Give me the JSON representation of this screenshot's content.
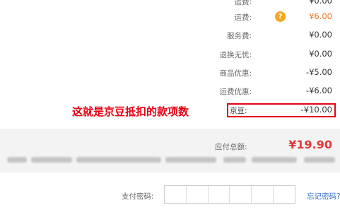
{
  "fees": [
    {
      "label": "运费:",
      "value": "¥0.00"
    },
    {
      "label": "运费:",
      "value": "¥6.00",
      "info_icon": "?"
    },
    {
      "label": "服务费:",
      "value": "¥0.00"
    },
    {
      "label": "退换无忧:",
      "value": "¥0.00"
    },
    {
      "label": "商品优惠:",
      "value": "-¥5.00"
    },
    {
      "label": "运费优惠:",
      "value": "-¥6.00"
    }
  ],
  "jd_bean": {
    "label": "京豆:",
    "value": "-¥10.00",
    "annotation": "这就是京豆抵扣的款项数"
  },
  "total": {
    "label": "应付总额:",
    "value": "¥19.90"
  },
  "payment": {
    "password_label": "支付密码:",
    "forgot_link": "忘记密码?"
  },
  "colors": {
    "highlight_red": "#e60012",
    "total_red": "#e4393c",
    "link_blue": "#3374d0",
    "icon_orange": "#f5a623"
  }
}
